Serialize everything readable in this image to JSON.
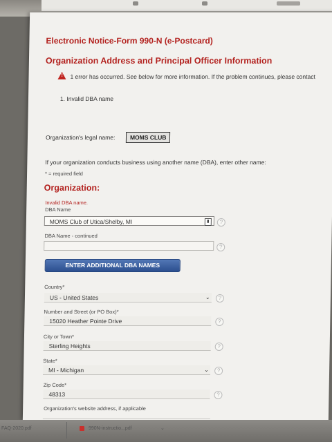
{
  "header": {
    "form_title": "Electronic Notice-Form 990-N (e-Postcard)",
    "section_title": "Organization Address and Principal Officer Information"
  },
  "error_box": {
    "message": "1 error has occurred. See below for more information. If the problem continues, please contact",
    "item": "1. Invalid DBA name"
  },
  "legal_name": {
    "label": "Organization's legal name:",
    "value": "MOMS CLUB"
  },
  "dba_intro": "If your organization conducts business using another name (DBA), enter other name:",
  "required_note": "* = required field",
  "organization_heading": "Organization:",
  "fields": {
    "dba_error": "Invalid DBA name.",
    "dba_label": "DBA Name",
    "dba_value": "MOMS Club of Utica/Shelby, MI",
    "dba_cont_label": "DBA Name - continued",
    "dba_cont_value": "",
    "add_dba_button": "ENTER ADDITIONAL DBA NAMES",
    "country_label": "Country*",
    "country_value": "US - United States",
    "street_label": "Number and Street (or PO Box)*",
    "street_value": "15020 Heather Pointe Drive",
    "city_label": "City or Town*",
    "city_value": "Sterling Heights",
    "state_label": "State*",
    "state_value": "MI - Michigan",
    "zip_label": "Zip Code*",
    "zip_value": "48313",
    "website_label": "Organization's website address, if applicable"
  },
  "downloads": {
    "item1": "FAQ-2020.pdf",
    "item2": "990N-instructio...pdf"
  },
  "icons": {
    "warning": "warning-triangle-icon",
    "help": "help-question-icon",
    "dropdown": "chevron-down-icon",
    "field_badge": "field-indicator-icon",
    "pdf": "pdf-file-icon"
  }
}
